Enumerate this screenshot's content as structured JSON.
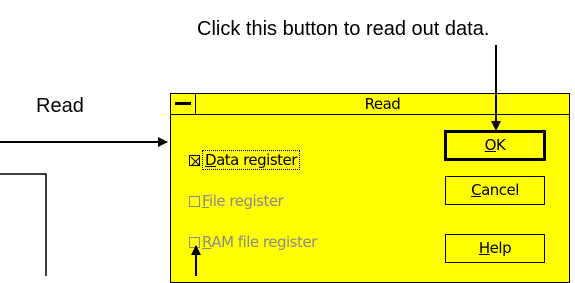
{
  "annotations": {
    "top": "Click this button to read out data.",
    "left": "Read"
  },
  "dialog": {
    "title": "Read",
    "checkboxes": [
      {
        "prefix": "",
        "accel": "D",
        "rest": "ata register",
        "checked": true,
        "enabled": true
      },
      {
        "prefix": "",
        "accel": "F",
        "rest": "ile register",
        "checked": false,
        "enabled": false
      },
      {
        "prefix": "",
        "accel": "R",
        "rest": "AM file register",
        "checked": false,
        "enabled": false
      }
    ],
    "buttons": {
      "ok": {
        "accel": "O",
        "rest": "K"
      },
      "cancel": {
        "accel": "C",
        "rest": "ancel"
      },
      "help": {
        "accel": "H",
        "rest": "elp"
      }
    }
  },
  "colors": {
    "dialog_bg": "#ffff00",
    "disabled_text": "#8a8a8a"
  }
}
